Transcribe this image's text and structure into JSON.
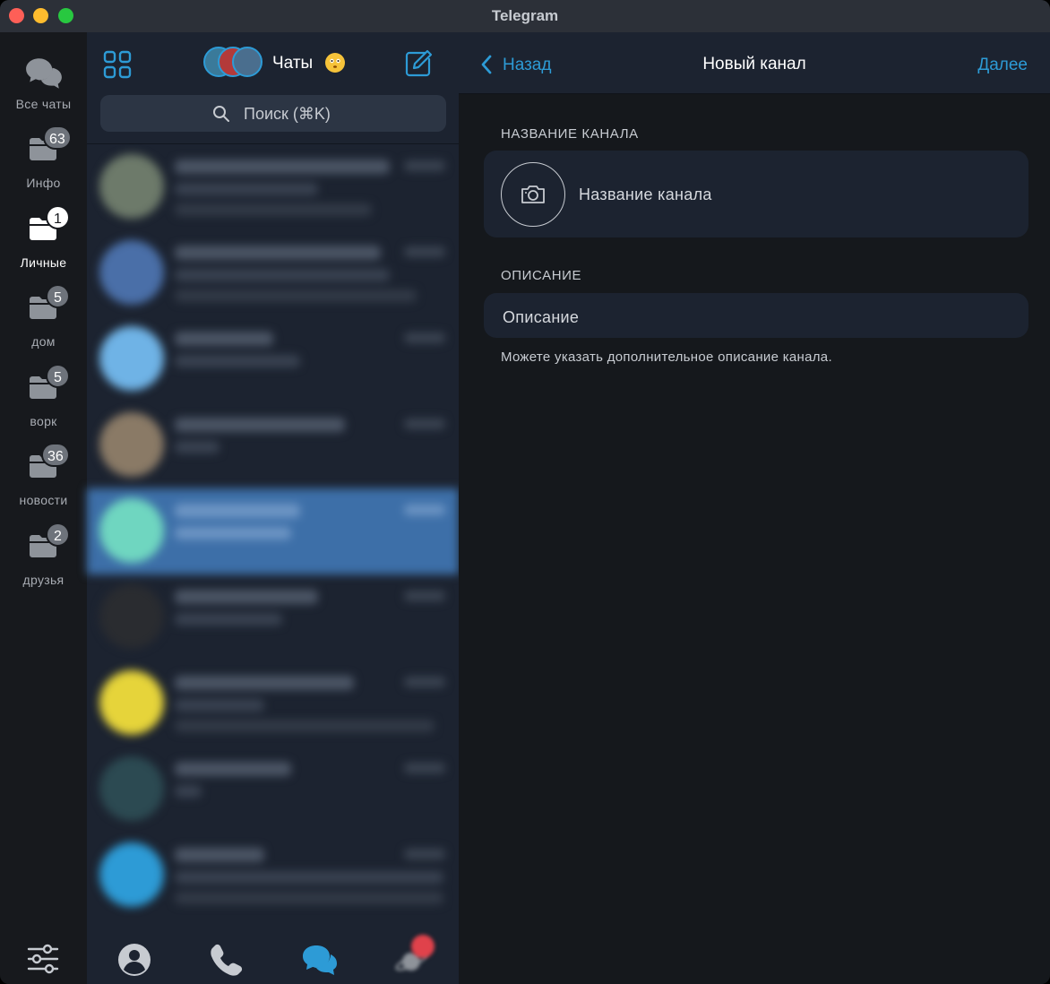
{
  "window": {
    "title": "Telegram"
  },
  "folders": [
    {
      "label": "Все чаты",
      "badge": null,
      "icon": "chats-icon",
      "active": false
    },
    {
      "label": "Инфо",
      "badge": "63",
      "icon": "folder-icon",
      "active": false
    },
    {
      "label": "Личные",
      "badge": "1",
      "icon": "folder-icon",
      "active": true
    },
    {
      "label": "дом",
      "badge": "5",
      "icon": "folder-icon",
      "active": false
    },
    {
      "label": "ворк",
      "badge": "5",
      "icon": "folder-icon",
      "active": false
    },
    {
      "label": "новости",
      "badge": "36",
      "icon": "folder-icon",
      "active": false
    },
    {
      "label": "друзья",
      "badge": "2",
      "icon": "folder-icon",
      "active": false
    }
  ],
  "chatlist": {
    "title": "Чаты",
    "search_placeholder": "Поиск (⌘K)",
    "selected_index": 4
  },
  "panel": {
    "back_label": "Назад",
    "title": "Новый канал",
    "next_label": "Далее",
    "name_section": "НАЗВАНИЕ КАНАЛА",
    "name_placeholder": "Название канала",
    "desc_section": "ОПИСАНИЕ",
    "desc_placeholder": "Описание",
    "desc_hint": "Можете указать дополнительное описание канала."
  },
  "colors": {
    "accent": "#2d9bd6",
    "sidebar_bg": "#1c2330",
    "panel_bg": "#15181c",
    "selected_row": "#3d6fa8",
    "badge_red": "#e0424b"
  },
  "icons": [
    "grid-icon",
    "compose-icon",
    "search-icon",
    "camera-icon",
    "chevron-left-icon",
    "settings-sliders-icon",
    "profile-icon",
    "phone-icon",
    "chats-icon",
    "saturn-icon"
  ]
}
